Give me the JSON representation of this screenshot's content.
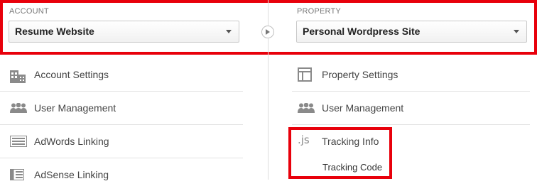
{
  "account": {
    "label": "ACCOUNT",
    "selected": "Resume Website"
  },
  "property": {
    "label": "PROPERTY",
    "selected": "Personal Wordpress Site"
  },
  "account_menu": [
    {
      "label": "Account Settings",
      "icon": "building-icon"
    },
    {
      "label": "User Management",
      "icon": "users-icon"
    },
    {
      "label": "AdWords Linking",
      "icon": "adwords-icon"
    },
    {
      "label": "AdSense Linking",
      "icon": "adsense-icon"
    }
  ],
  "property_menu": [
    {
      "label": "Property Settings",
      "icon": "layout-icon"
    },
    {
      "label": "User Management",
      "icon": "users-icon"
    },
    {
      "label": "Tracking Info",
      "icon": "js-icon",
      "icon_text": ".js"
    }
  ],
  "tracking_sub": {
    "label": "Tracking Code"
  },
  "colors": {
    "highlight": "#e8000b",
    "text": "#444444",
    "icon": "#8a8a8a"
  }
}
